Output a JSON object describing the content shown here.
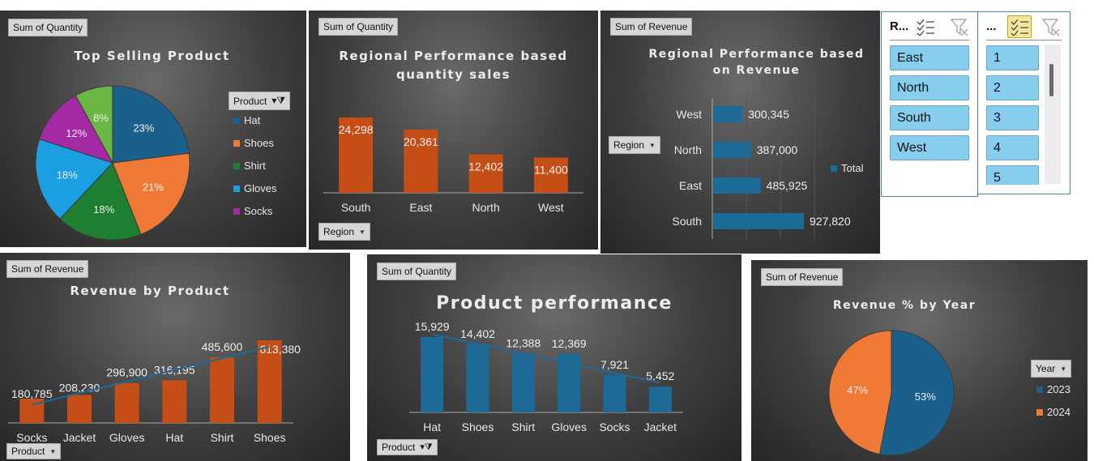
{
  "colors": {
    "bar_orange": "#c44e16",
    "bar_blue": "#1d6a96",
    "pie_hat": "#1b5f8c",
    "pie_shoes": "#f07a35",
    "pie_shirt": "#1f7f30",
    "pie_gloves": "#1b9ee2",
    "pie_socks": "#a32aa3",
    "pie_lime": "#6ab744",
    "slicer_fill": "#87cdee"
  },
  "p1": {
    "tag": "Sum of Quantity",
    "title": "Top Selling Product",
    "filter_label": "Product",
    "legend": [
      "Hat",
      "Shoes",
      "Shirt",
      "Gloves",
      "Socks"
    ]
  },
  "p2": {
    "tag": "Sum of Quantity",
    "title_line1": "Regional Performance based",
    "title_line2": "quantity sales",
    "filter_label": "Region"
  },
  "p3": {
    "tag": "Sum of Revenue",
    "title_line1": "Regional Performance based",
    "title_line2": "on Revenue",
    "filter_label": "Region",
    "legend": "Total"
  },
  "slicer_region": {
    "header": "R...",
    "items": [
      "East",
      "North",
      "South",
      "West"
    ]
  },
  "slicer_month": {
    "header": "...",
    "items": [
      "1",
      "2",
      "3",
      "4",
      "5"
    ]
  },
  "p4": {
    "tag": "Sum of Revenue",
    "title": "Revenue by Product",
    "filter_label": "Product"
  },
  "p5": {
    "tag": "Sum of Quantity",
    "title": "Product performance",
    "filter_label": "Product"
  },
  "p6": {
    "tag": "Sum of Revenue",
    "title": "Revenue % by Year",
    "filter_label": "Year",
    "legend": [
      "2023",
      "2024"
    ]
  },
  "chart_data": [
    {
      "type": "pie",
      "title": "Top Selling Product",
      "slices": [
        {
          "name": "Hat",
          "value": 23,
          "label": "23%"
        },
        {
          "name": "Shoes",
          "value": 21,
          "label": "21%"
        },
        {
          "name": "Shirt",
          "value": 18,
          "label": "18%"
        },
        {
          "name": "Gloves",
          "value": 18,
          "label": "18%"
        },
        {
          "name": "Socks",
          "value": 12,
          "label": "12%"
        },
        {
          "name": "",
          "value": 8,
          "label": "8%"
        }
      ]
    },
    {
      "type": "bar",
      "title": "Regional Performance based quantity sales",
      "categories": [
        "South",
        "East",
        "North",
        "West"
      ],
      "values": [
        24298,
        20361,
        12402,
        11400
      ],
      "labels": [
        "24,298",
        "20,361",
        "12,402",
        "11,400"
      ]
    },
    {
      "type": "bar",
      "orientation": "horizontal",
      "title": "Regional Performance based on Revenue",
      "categories": [
        "West",
        "North",
        "East",
        "South"
      ],
      "values": [
        300345,
        387000,
        485925,
        927820
      ],
      "labels": [
        "300,345",
        "387,000",
        "485,925",
        "927,820"
      ],
      "series_name": "Total"
    },
    {
      "type": "bar",
      "title": "Revenue by Product",
      "categories": [
        "Socks",
        "Jacket",
        "Gloves",
        "Hat",
        "Shirt",
        "Shoes"
      ],
      "values": [
        180785,
        208230,
        296900,
        316195,
        485600,
        613380
      ],
      "labels": [
        "180,785",
        "208,230",
        "296,900",
        "316,195",
        "485,600",
        "613,380"
      ],
      "trendline": "linear"
    },
    {
      "type": "bar",
      "title": "Product performance",
      "categories": [
        "Hat",
        "Shoes",
        "Shirt",
        "Gloves",
        "Socks",
        "Jacket"
      ],
      "values": [
        15929,
        14402,
        12388,
        12369,
        7921,
        5452
      ],
      "labels": [
        "15,929",
        "14,402",
        "12,388",
        "12,369",
        "7,921",
        "5,452"
      ],
      "trendline": "linear"
    },
    {
      "type": "pie",
      "title": "Revenue % by Year",
      "slices": [
        {
          "name": "2023",
          "value": 53,
          "label": "53%"
        },
        {
          "name": "2024",
          "value": 47,
          "label": "47%"
        }
      ]
    }
  ]
}
